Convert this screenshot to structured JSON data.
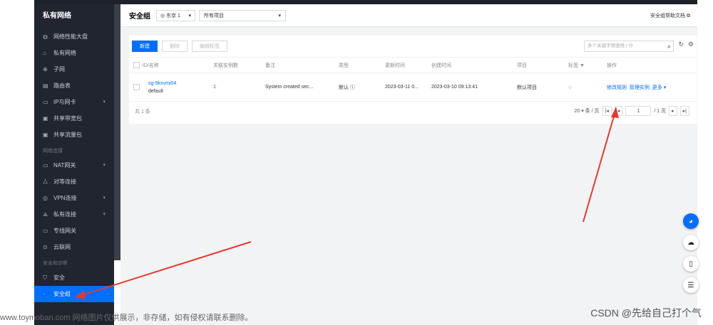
{
  "sidebar": {
    "title": "私有网络",
    "items": [
      {
        "label": "网络性能大盘",
        "icon": "dashboard-icon",
        "glyph": "◍"
      },
      {
        "label": "私有网络",
        "icon": "network-icon",
        "glyph": "⌂"
      },
      {
        "label": "子网",
        "icon": "subnet-icon",
        "glyph": "⊕"
      },
      {
        "label": "路由表",
        "icon": "route-table-icon",
        "glyph": "▤"
      },
      {
        "label": "IP与网卡",
        "icon": "ip-card-icon",
        "glyph": "▭",
        "caret": "▾"
      },
      {
        "label": "共享带宽包",
        "icon": "bandwidth-icon",
        "glyph": "▣"
      },
      {
        "label": "共享流量包",
        "icon": "traffic-icon",
        "glyph": "▣"
      }
    ],
    "group_connect": "网络连接",
    "connect_items": [
      {
        "label": "NAT网关",
        "icon": "nat-icon",
        "glyph": "▭",
        "caret": "▾"
      },
      {
        "label": "对等连接",
        "icon": "peering-icon",
        "glyph": "⧊"
      },
      {
        "label": "VPN连接",
        "icon": "vpn-icon",
        "glyph": "◎",
        "caret": "▾"
      },
      {
        "label": "私有连接",
        "icon": "private-link-icon",
        "glyph": "⟁",
        "caret": "▾"
      },
      {
        "label": "专线网关",
        "icon": "dc-gateway-icon",
        "glyph": "▭"
      },
      {
        "label": "云联网",
        "icon": "ccn-icon",
        "glyph": "⊙"
      }
    ],
    "group_security": "安全和诊断",
    "security_items": [
      {
        "label": "安全",
        "icon": "shield-icon",
        "glyph": "⛉"
      },
      {
        "label": "安全组",
        "icon": "dot-icon",
        "glyph": "·"
      }
    ]
  },
  "header": {
    "title": "安全组",
    "region": "东京 1",
    "project": "所有项目",
    "help": "安全组帮助文档 ⧉"
  },
  "toolbar": {
    "new_label": "新建",
    "delete_label": "删除",
    "edit_tags_label": "编辑标签",
    "search_placeholder": "多个关键字用竖线 | 分"
  },
  "table": {
    "headers": [
      "ID/名称",
      "关联实例数",
      "备注",
      "类型",
      "更新时间",
      "创建时间",
      "项目",
      "标签",
      "操作"
    ],
    "row": {
      "id": "sg-9kxvmi04",
      "name": "default",
      "count": "1",
      "remark": "System created sec...",
      "type": "默认 ⓘ",
      "updated": "2023-03-11 0...",
      "created": "2023-03-10 09:13:41",
      "project": "默认项目",
      "ops": {
        "edit_rules": "修改规则",
        "manage": "管理实例",
        "more": "更多 ▾"
      }
    }
  },
  "footer": {
    "total": "共 1 条",
    "page_size": "20 ▾ 条 / 页",
    "page_input": "1",
    "page_total": "/ 1 页"
  },
  "watermark": "www.toymoban.com 网络图片仅供展示，非存储，如有侵权请联系删除。",
  "csdn": "CSDN @先给自己打个气",
  "colors": {
    "accent": "#006eff",
    "sidebar_bg": "#21252f",
    "arrow": "#e8382f"
  }
}
